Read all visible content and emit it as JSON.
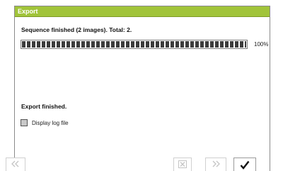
{
  "window": {
    "title": "Export"
  },
  "status": {
    "text": "Sequence finished (2 images). Total: 2."
  },
  "progress": {
    "value": 1.0,
    "label": "100%"
  },
  "result": {
    "text": "Export finished."
  },
  "log_option": {
    "label": "Display log file",
    "checked": false
  },
  "buttons": {
    "back_icon": "double-chevron-left-icon",
    "cancel_icon": "x-box-icon",
    "next_icon": "double-chevron-right-icon",
    "ok_icon": "checkmark-icon"
  }
}
